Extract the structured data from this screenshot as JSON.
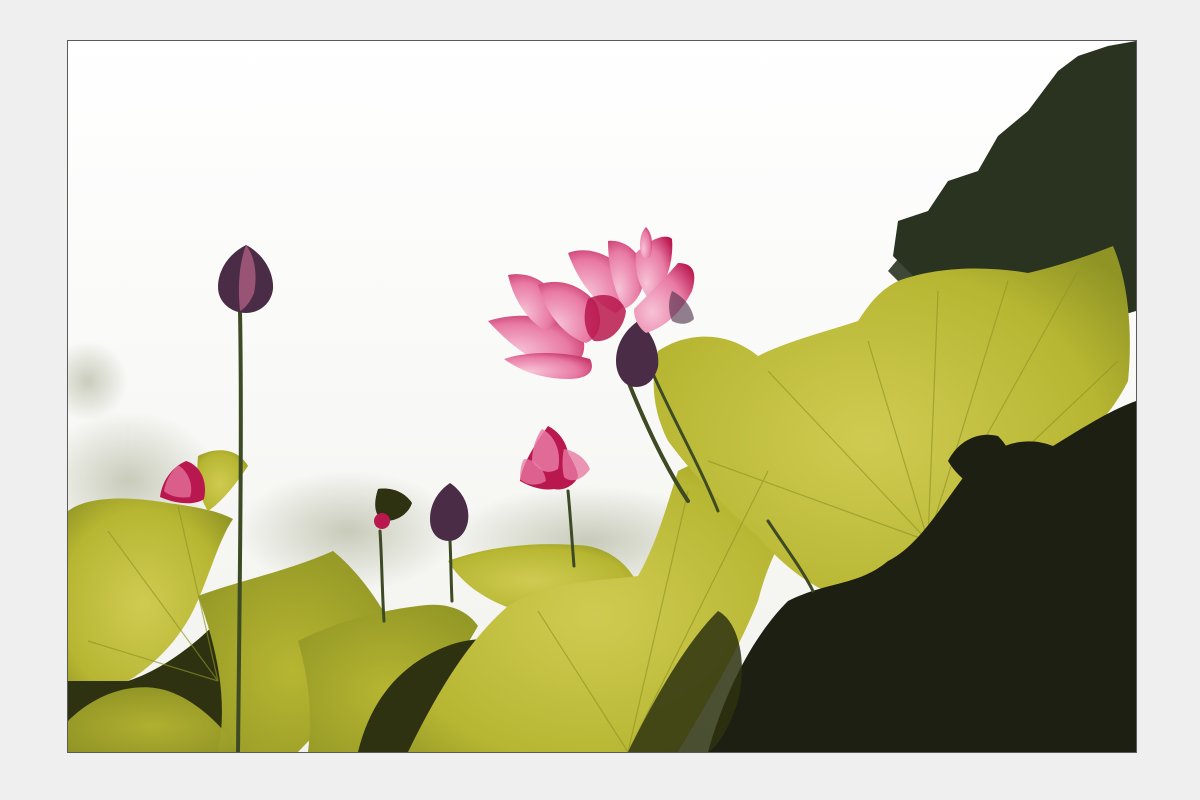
{
  "colors": {
    "mat": "#efefef",
    "frame_border": "#5a5a5a",
    "sky_top": "#ffffff",
    "sky_bottom": "#f2f2ee",
    "leaf_lit": "#b7b632",
    "leaf_lit_light": "#cfcb52",
    "leaf_mid": "#8f9424",
    "leaf_shadow": "#2e3210",
    "foliage_dark": "#1c1f12",
    "tree_canopy": "#2a3320",
    "lotus_pink": "#e87aa4",
    "lotus_pink_light": "#f7c3d6",
    "lotus_deep": "#b9184e",
    "bud_purple": "#4a2c46",
    "stem": "#3d4a24"
  },
  "scene": {
    "subject": "lotus-flower-icon",
    "background": "sky-icon",
    "elements": [
      "lotus-flower-icon",
      "lotus-bud-icon",
      "lotus-leaf-icon",
      "tree-silhouette-icon"
    ]
  }
}
